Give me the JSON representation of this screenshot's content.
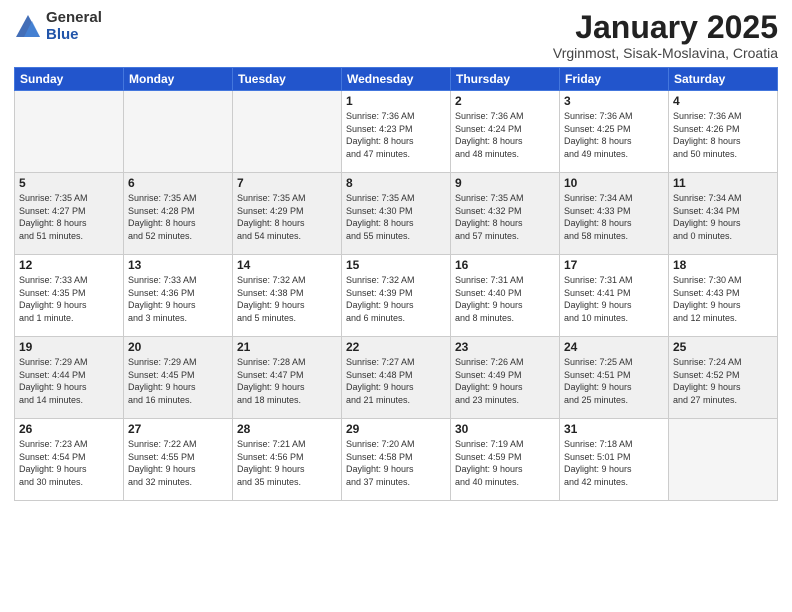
{
  "logo": {
    "general": "General",
    "blue": "Blue"
  },
  "header": {
    "month": "January 2025",
    "location": "Vrginmost, Sisak-Moslavina, Croatia"
  },
  "weekdays": [
    "Sunday",
    "Monday",
    "Tuesday",
    "Wednesday",
    "Thursday",
    "Friday",
    "Saturday"
  ],
  "weeks": [
    [
      {
        "day": "",
        "info": ""
      },
      {
        "day": "",
        "info": ""
      },
      {
        "day": "",
        "info": ""
      },
      {
        "day": "1",
        "info": "Sunrise: 7:36 AM\nSunset: 4:23 PM\nDaylight: 8 hours\nand 47 minutes."
      },
      {
        "day": "2",
        "info": "Sunrise: 7:36 AM\nSunset: 4:24 PM\nDaylight: 8 hours\nand 48 minutes."
      },
      {
        "day": "3",
        "info": "Sunrise: 7:36 AM\nSunset: 4:25 PM\nDaylight: 8 hours\nand 49 minutes."
      },
      {
        "day": "4",
        "info": "Sunrise: 7:36 AM\nSunset: 4:26 PM\nDaylight: 8 hours\nand 50 minutes."
      }
    ],
    [
      {
        "day": "5",
        "info": "Sunrise: 7:35 AM\nSunset: 4:27 PM\nDaylight: 8 hours\nand 51 minutes."
      },
      {
        "day": "6",
        "info": "Sunrise: 7:35 AM\nSunset: 4:28 PM\nDaylight: 8 hours\nand 52 minutes."
      },
      {
        "day": "7",
        "info": "Sunrise: 7:35 AM\nSunset: 4:29 PM\nDaylight: 8 hours\nand 54 minutes."
      },
      {
        "day": "8",
        "info": "Sunrise: 7:35 AM\nSunset: 4:30 PM\nDaylight: 8 hours\nand 55 minutes."
      },
      {
        "day": "9",
        "info": "Sunrise: 7:35 AM\nSunset: 4:32 PM\nDaylight: 8 hours\nand 57 minutes."
      },
      {
        "day": "10",
        "info": "Sunrise: 7:34 AM\nSunset: 4:33 PM\nDaylight: 8 hours\nand 58 minutes."
      },
      {
        "day": "11",
        "info": "Sunrise: 7:34 AM\nSunset: 4:34 PM\nDaylight: 9 hours\nand 0 minutes."
      }
    ],
    [
      {
        "day": "12",
        "info": "Sunrise: 7:33 AM\nSunset: 4:35 PM\nDaylight: 9 hours\nand 1 minute."
      },
      {
        "day": "13",
        "info": "Sunrise: 7:33 AM\nSunset: 4:36 PM\nDaylight: 9 hours\nand 3 minutes."
      },
      {
        "day": "14",
        "info": "Sunrise: 7:32 AM\nSunset: 4:38 PM\nDaylight: 9 hours\nand 5 minutes."
      },
      {
        "day": "15",
        "info": "Sunrise: 7:32 AM\nSunset: 4:39 PM\nDaylight: 9 hours\nand 6 minutes."
      },
      {
        "day": "16",
        "info": "Sunrise: 7:31 AM\nSunset: 4:40 PM\nDaylight: 9 hours\nand 8 minutes."
      },
      {
        "day": "17",
        "info": "Sunrise: 7:31 AM\nSunset: 4:41 PM\nDaylight: 9 hours\nand 10 minutes."
      },
      {
        "day": "18",
        "info": "Sunrise: 7:30 AM\nSunset: 4:43 PM\nDaylight: 9 hours\nand 12 minutes."
      }
    ],
    [
      {
        "day": "19",
        "info": "Sunrise: 7:29 AM\nSunset: 4:44 PM\nDaylight: 9 hours\nand 14 minutes."
      },
      {
        "day": "20",
        "info": "Sunrise: 7:29 AM\nSunset: 4:45 PM\nDaylight: 9 hours\nand 16 minutes."
      },
      {
        "day": "21",
        "info": "Sunrise: 7:28 AM\nSunset: 4:47 PM\nDaylight: 9 hours\nand 18 minutes."
      },
      {
        "day": "22",
        "info": "Sunrise: 7:27 AM\nSunset: 4:48 PM\nDaylight: 9 hours\nand 21 minutes."
      },
      {
        "day": "23",
        "info": "Sunrise: 7:26 AM\nSunset: 4:49 PM\nDaylight: 9 hours\nand 23 minutes."
      },
      {
        "day": "24",
        "info": "Sunrise: 7:25 AM\nSunset: 4:51 PM\nDaylight: 9 hours\nand 25 minutes."
      },
      {
        "day": "25",
        "info": "Sunrise: 7:24 AM\nSunset: 4:52 PM\nDaylight: 9 hours\nand 27 minutes."
      }
    ],
    [
      {
        "day": "26",
        "info": "Sunrise: 7:23 AM\nSunset: 4:54 PM\nDaylight: 9 hours\nand 30 minutes."
      },
      {
        "day": "27",
        "info": "Sunrise: 7:22 AM\nSunset: 4:55 PM\nDaylight: 9 hours\nand 32 minutes."
      },
      {
        "day": "28",
        "info": "Sunrise: 7:21 AM\nSunset: 4:56 PM\nDaylight: 9 hours\nand 35 minutes."
      },
      {
        "day": "29",
        "info": "Sunrise: 7:20 AM\nSunset: 4:58 PM\nDaylight: 9 hours\nand 37 minutes."
      },
      {
        "day": "30",
        "info": "Sunrise: 7:19 AM\nSunset: 4:59 PM\nDaylight: 9 hours\nand 40 minutes."
      },
      {
        "day": "31",
        "info": "Sunrise: 7:18 AM\nSunset: 5:01 PM\nDaylight: 9 hours\nand 42 minutes."
      },
      {
        "day": "",
        "info": ""
      }
    ]
  ]
}
